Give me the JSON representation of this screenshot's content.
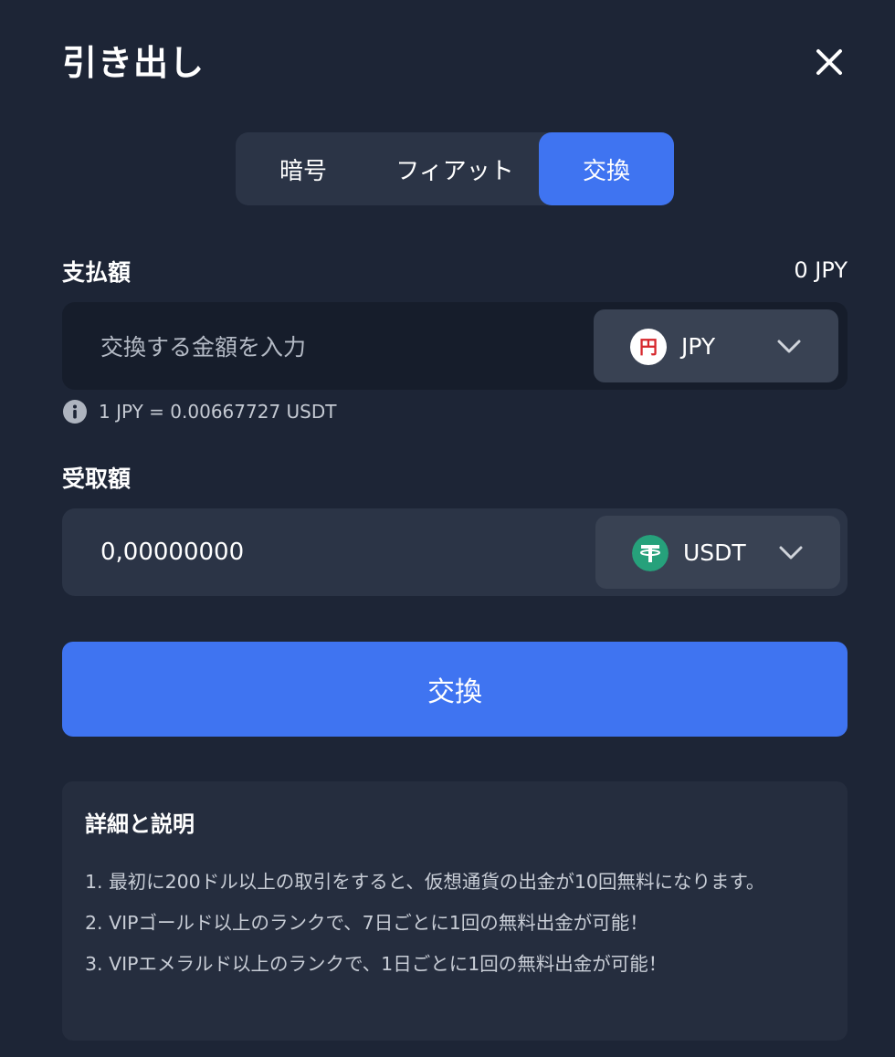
{
  "dialog": {
    "title": "引き出し"
  },
  "tabs": [
    {
      "label": "暗号",
      "active": false
    },
    {
      "label": "フィアット",
      "active": false
    },
    {
      "label": "交換",
      "active": true
    }
  ],
  "pay": {
    "label": "支払額",
    "balance": "0 JPY",
    "placeholder": "交換する金額を入力",
    "currency": "JPY",
    "currency_icon_glyph": "円",
    "currency_icon": "yen-coin-icon"
  },
  "rate": {
    "text": "1 JPY = 0.00667727 USDT"
  },
  "receive": {
    "label": "受取額",
    "value": "0,00000000",
    "currency": "USDT",
    "currency_icon": "tether-coin-icon"
  },
  "submit": {
    "label": "交換"
  },
  "details": {
    "title": "詳細と説明",
    "items": [
      "1. 最初に200ドル以上の取引をすると、仮想通貨の出金が10回無料になります。",
      "2. VIPゴールド以上のランクで、7日ごとに1回の無料出金が可能！",
      "3. VIPエメラルド以上のランクで、1日ごとに1回の無料出金が可能！"
    ]
  },
  "colors": {
    "background": "#1d2536",
    "accent": "#3f74f1",
    "tether": "#26a17b",
    "yen_red": "#d6262b"
  }
}
